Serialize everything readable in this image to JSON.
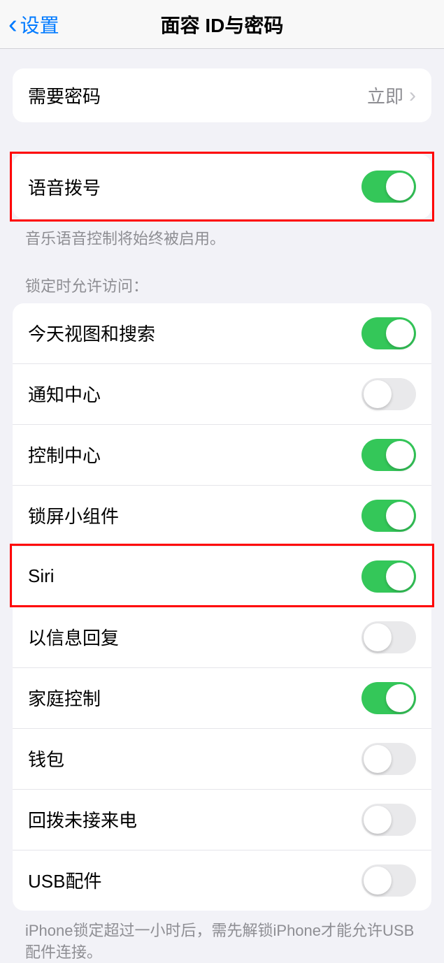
{
  "header": {
    "back_label": "设置",
    "title": "面容 ID与密码"
  },
  "passcode_group": {
    "require_passcode_label": "需要密码",
    "require_passcode_value": "立即"
  },
  "voice_dial": {
    "label": "语音拨号",
    "on": true,
    "footer": "音乐语音控制将始终被启用。"
  },
  "lock_access": {
    "section_header": "锁定时允许访问：",
    "items": [
      {
        "label": "今天视图和搜索",
        "on": true
      },
      {
        "label": "通知中心",
        "on": false
      },
      {
        "label": "控制中心",
        "on": true
      },
      {
        "label": "锁屏小组件",
        "on": true
      },
      {
        "label": "Siri",
        "on": true
      },
      {
        "label": "以信息回复",
        "on": false
      },
      {
        "label": "家庭控制",
        "on": true
      },
      {
        "label": "钱包",
        "on": false
      },
      {
        "label": "回拨未接来电",
        "on": false
      },
      {
        "label": "USB配件",
        "on": false
      }
    ],
    "footer": "iPhone锁定超过一小时后，需先解锁iPhone才能允许USB 配件连接。"
  }
}
